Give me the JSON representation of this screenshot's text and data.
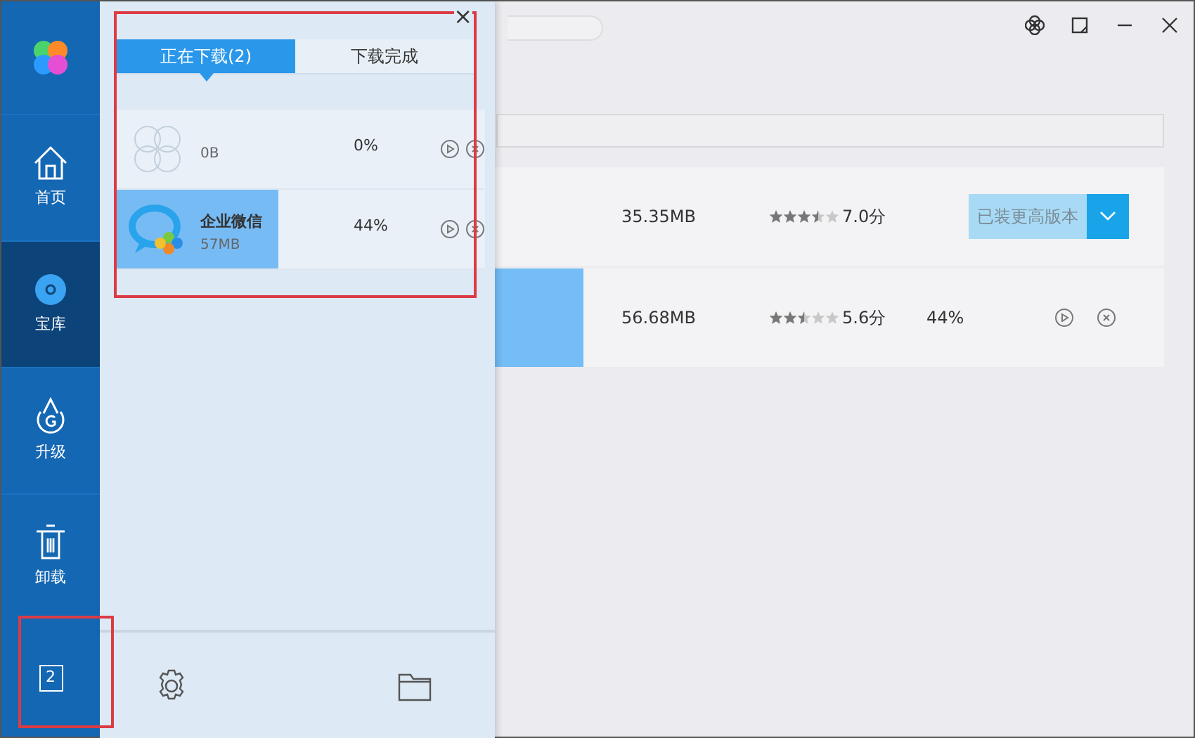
{
  "sidebar": {
    "items": [
      {
        "label": "首页",
        "selected": false
      },
      {
        "label": "宝库",
        "selected": true
      },
      {
        "label": "升级",
        "selected": false
      },
      {
        "label": "卸载",
        "selected": false
      }
    ],
    "download_count": "2"
  },
  "download_panel": {
    "close": "×",
    "tabs": [
      {
        "label": "正在下载(2)",
        "selected": true
      },
      {
        "label": "下载完成",
        "selected": false
      }
    ],
    "items": [
      {
        "size": "0B",
        "percent": "0%",
        "level": 0
      },
      {
        "name": "企业微信",
        "size": "57MB",
        "percent": "44%",
        "level": 0.44
      }
    ]
  },
  "app_rows": [
    {
      "kind": "installed",
      "size": "35.35MB",
      "stars": 3.5,
      "score": "7.0分",
      "button": "已装更高版本"
    },
    {
      "kind": "downloading",
      "size": "56.68MB",
      "stars": 2.5,
      "score": "5.6分",
      "percent": "44%",
      "level": 0.44
    }
  ]
}
